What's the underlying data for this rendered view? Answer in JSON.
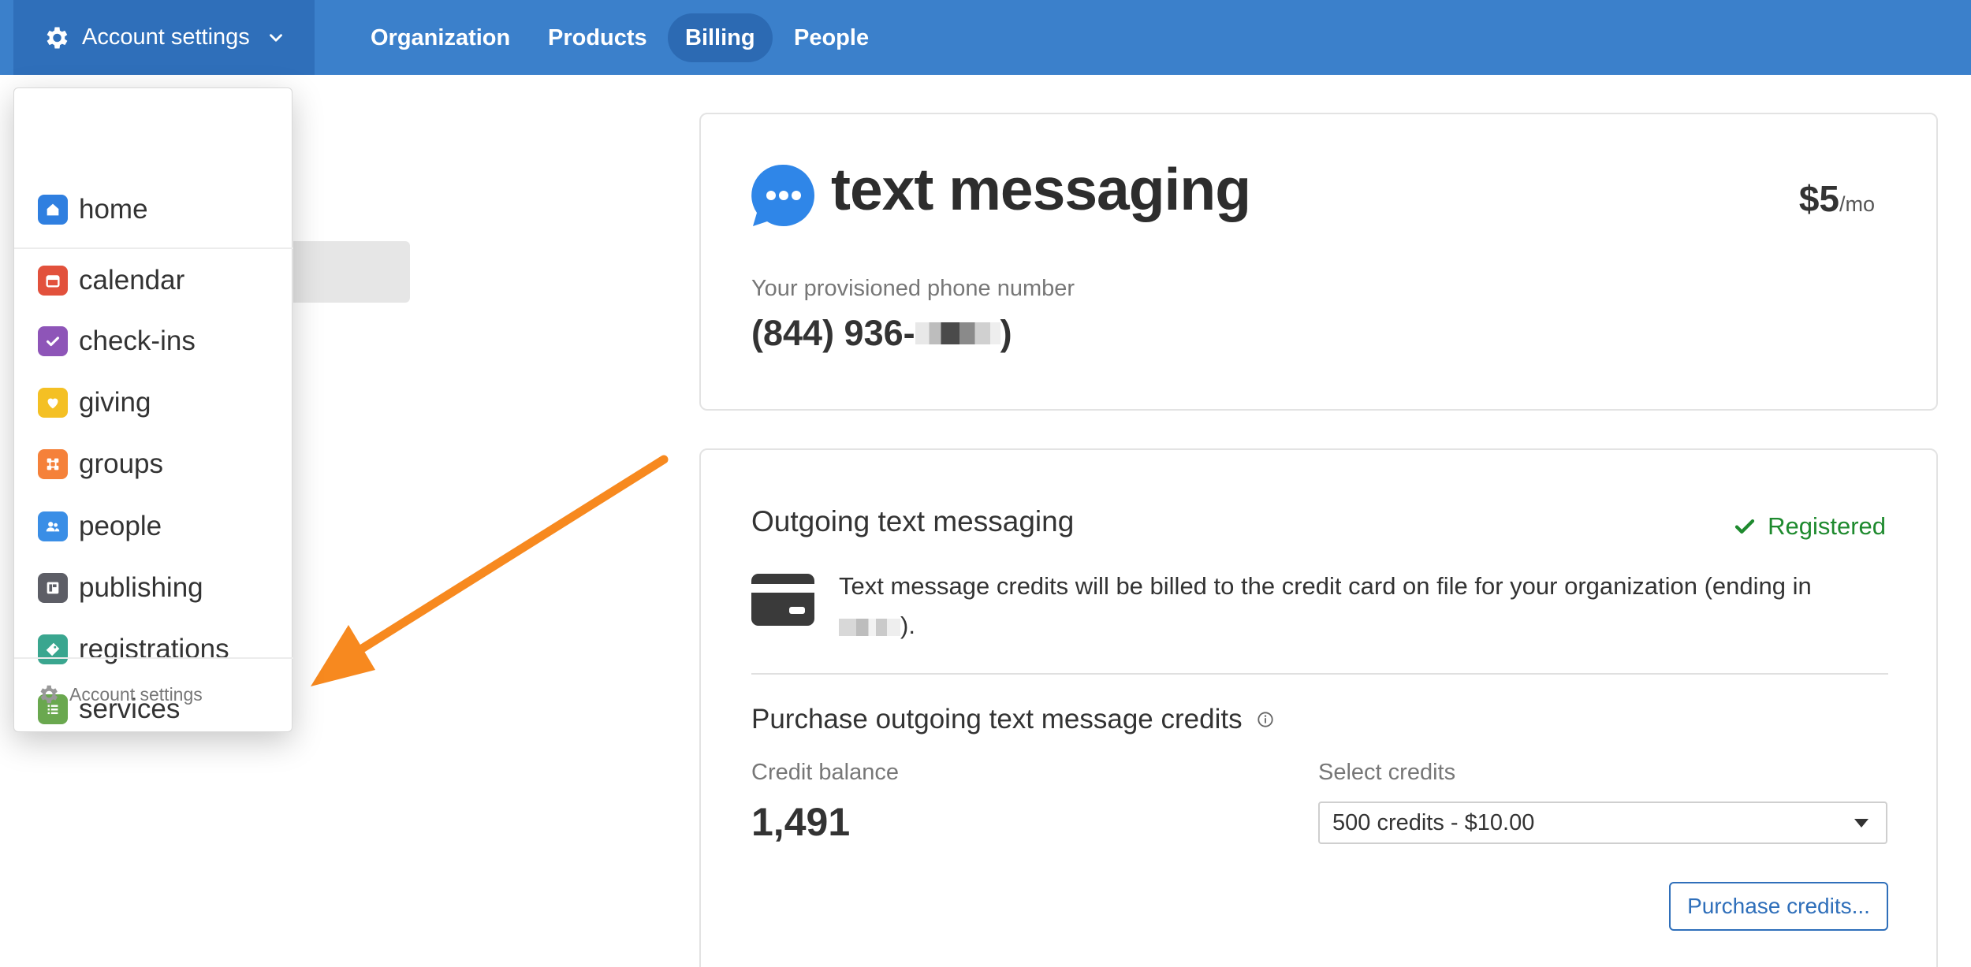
{
  "topbar": {
    "account_label": "Account settings",
    "nav": [
      {
        "label": "Organization"
      },
      {
        "label": "Products"
      },
      {
        "label": "Billing",
        "active": true
      },
      {
        "label": "People"
      }
    ]
  },
  "menu": {
    "items": [
      {
        "label": "home",
        "color": "#2f7fe0",
        "icon": "home-icon"
      },
      {
        "label": "calendar",
        "color": "#e2513c",
        "icon": "calendar-icon"
      },
      {
        "label": "check-ins",
        "color": "#8e55b8",
        "icon": "check-icon"
      },
      {
        "label": "giving",
        "color": "#f4c024",
        "icon": "heart-icon"
      },
      {
        "label": "groups",
        "color": "#f5813a",
        "icon": "groups-icon"
      },
      {
        "label": "people",
        "color": "#3a8ee6",
        "icon": "people-icon"
      },
      {
        "label": "publishing",
        "color": "#5d5e66",
        "icon": "publishing-icon"
      },
      {
        "label": "registrations",
        "color": "#3aa68f",
        "icon": "ticket-icon"
      },
      {
        "label": "services",
        "color": "#6aa84f",
        "icon": "list-icon"
      }
    ],
    "footer_label": "Account settings"
  },
  "product": {
    "title": "text messaging",
    "price": "$5",
    "price_period": "/mo",
    "phone_label": "Your provisioned phone number",
    "phone_prefix": "(844) 936-",
    "phone_suffix": ")"
  },
  "outgoing": {
    "title": "Outgoing text messaging",
    "status": "Registered",
    "billing_text": "Text message credits will be billed to the credit card on file for your organization (ending in",
    "billing_text_end": ").",
    "purchase_title": "Purchase outgoing text message credits",
    "balance_label": "Credit balance",
    "balance_value": "1,491",
    "select_label": "Select credits",
    "select_value": "500 credits - $10.00",
    "purchase_button": "Purchase credits..."
  },
  "colors": {
    "brand_blue": "#3b80cb",
    "accent_orange": "#f7891f",
    "success_green": "#1e8a2e"
  }
}
